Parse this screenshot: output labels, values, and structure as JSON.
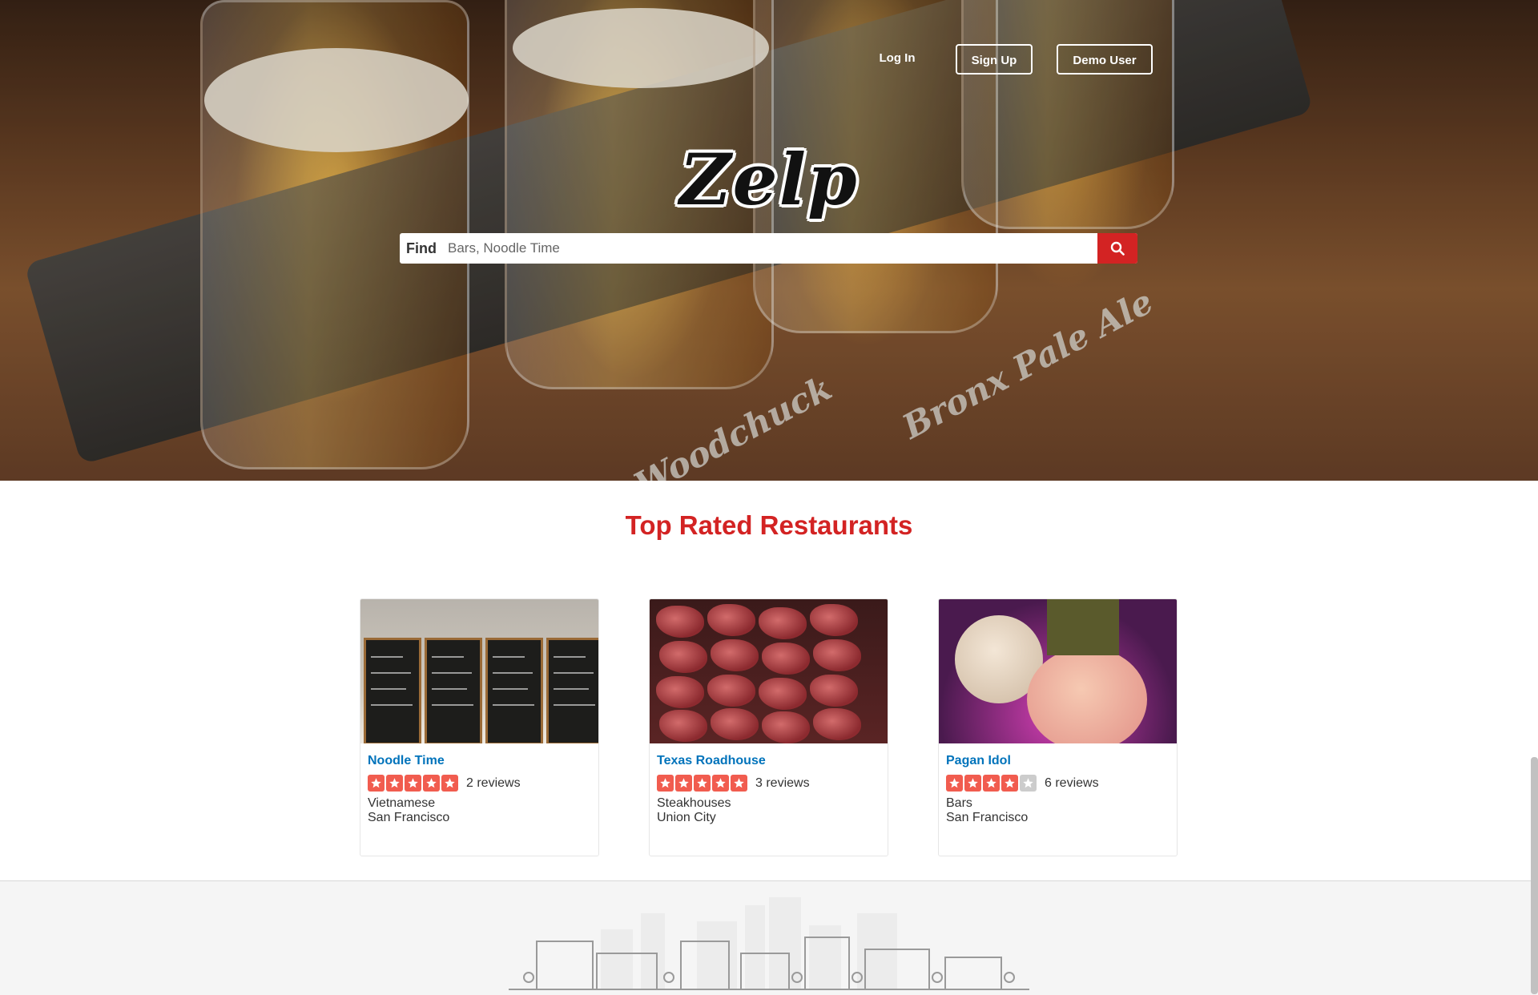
{
  "brand": {
    "logo": "Zelp",
    "accent": "#d32323"
  },
  "nav": {
    "login": "Log In",
    "signup": "Sign Up",
    "demo": "Demo User"
  },
  "search": {
    "find_label": "Find",
    "placeholder": "Bars, Noodle Time",
    "button_icon": "search-icon"
  },
  "section": {
    "title": "Top Rated Restaurants"
  },
  "restaurants": [
    {
      "name": "Noodle Time",
      "stars": 5,
      "reviews": "2 reviews",
      "category": "Vietnamese",
      "city": "San Francisco"
    },
    {
      "name": "Texas Roadhouse",
      "stars": 5,
      "reviews": "3 reviews",
      "category": "Steakhouses",
      "city": "Union City"
    },
    {
      "name": "Pagan Idol",
      "stars": 4,
      "reviews": "6 reviews",
      "category": "Bars",
      "city": "San Francisco"
    }
  ],
  "colors": {
    "star_on": "#f15c4f",
    "star_off": "#cccccc",
    "link": "#0073bb"
  }
}
